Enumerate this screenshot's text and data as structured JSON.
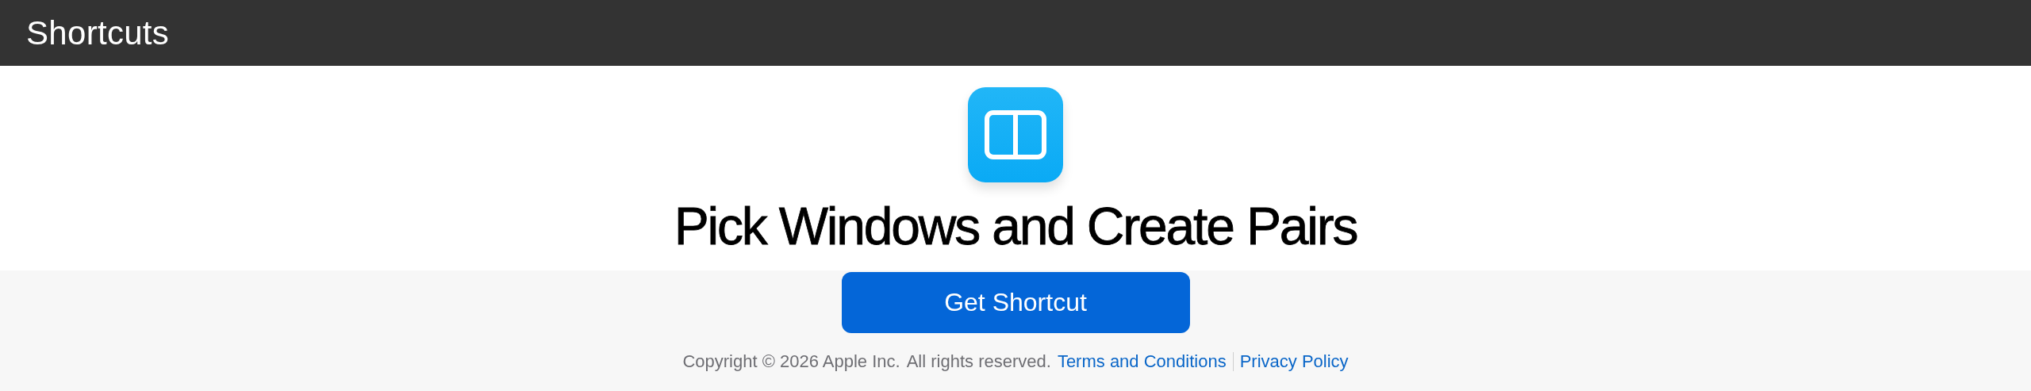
{
  "header": {
    "title": "Shortcuts"
  },
  "shortcut": {
    "title": "Pick Windows and Create Pairs",
    "button": "Get Shortcut"
  },
  "footer": {
    "copyright": "Copyright © 2026 Apple Inc.",
    "rights": "All rights reserved.",
    "links": [
      "Terms and Conditions",
      "Privacy Policy"
    ]
  }
}
